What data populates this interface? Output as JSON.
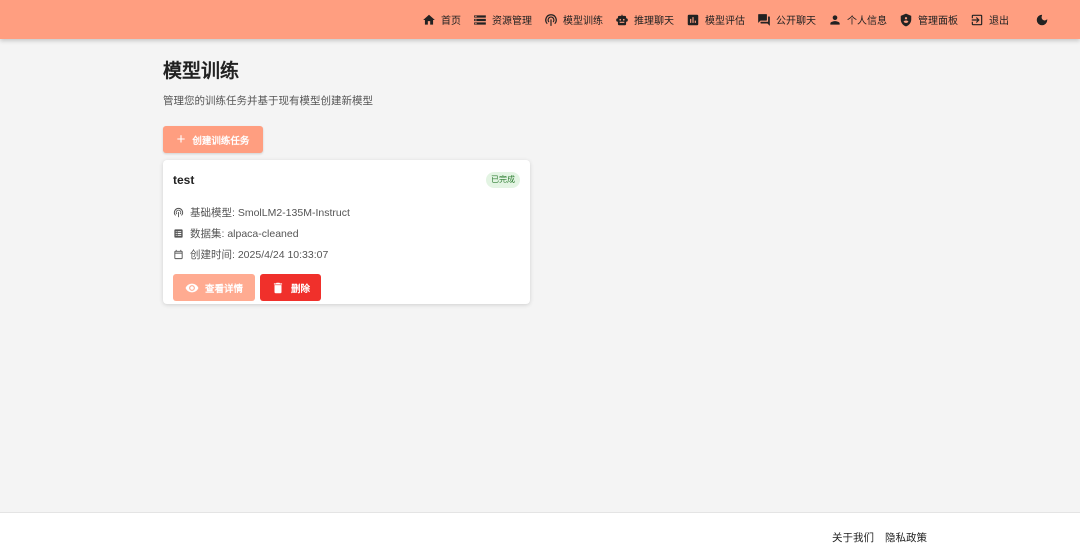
{
  "nav": {
    "items": [
      {
        "label": "首页",
        "icon": "home-icon"
      },
      {
        "label": "资源管理",
        "icon": "storage-icon"
      },
      {
        "label": "模型训练",
        "icon": "training-icon"
      },
      {
        "label": "推理聊天",
        "icon": "robot-icon"
      },
      {
        "label": "模型评估",
        "icon": "chart-icon"
      },
      {
        "label": "公开聊天",
        "icon": "forum-icon"
      },
      {
        "label": "个人信息",
        "icon": "person-icon"
      },
      {
        "label": "管理面板",
        "icon": "admin-shield-icon"
      },
      {
        "label": "退出",
        "icon": "logout-icon"
      }
    ],
    "theme_icon": "moon-icon"
  },
  "page": {
    "title": "模型训练",
    "subtitle": "管理您的训练任务并基于现有模型创建新模型",
    "create_button": "创建训练任务"
  },
  "tasks": [
    {
      "name": "test",
      "status": "已完成",
      "base_model": "基础模型: SmolLM2-135M-Instruct",
      "dataset": "数据集: alpaca-cleaned",
      "created": "创建时间: 2025/4/24 10:33:07",
      "view_label": "查看详情",
      "delete_label": "删除"
    }
  ],
  "footer": {
    "about": "关于我们",
    "privacy": "隐私政策"
  },
  "colors": {
    "accent": "#ff9e80",
    "danger": "#f0302b",
    "success_bg": "#e3f4e3",
    "success_text": "#2e7d32"
  }
}
